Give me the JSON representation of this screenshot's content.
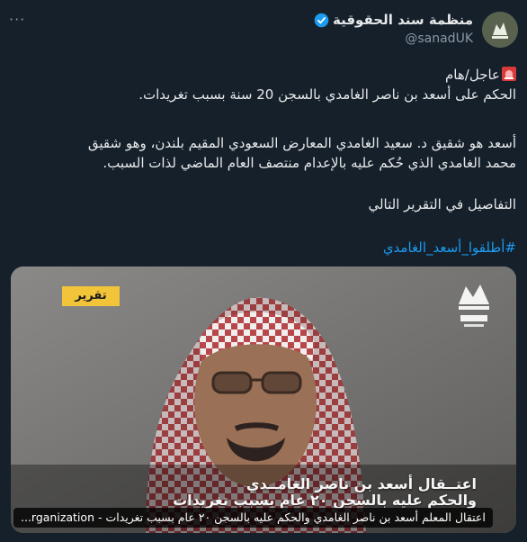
{
  "tweet": {
    "more_label": "···",
    "author": {
      "name": "منظمة سند الحقوقية",
      "handle": "@sanadUK",
      "verified": true
    },
    "lines": [
      "عاجل/هام",
      "الحكم على أسعد بن ناصر الغامدي بالسجن 20 سنة بسبب تغريدات.",
      "أسعد هو شقيق د. سعيد الغامدي المعارض السعودي المقيم بلندن، وهو شقيق",
      "محمد الغامدي الذي حُكم عليه بالإعدام منتصف العام الماضي لذات السبب.",
      "التفاصيل في التقرير التالي"
    ],
    "hashtag": "#أطلقوا_أسعد_الغامدي",
    "emoji": "siren-icon"
  },
  "media": {
    "tag": "تقرير",
    "logo_name": "sanad-logo",
    "caption_line1": "اعتــقال أسعد بن ناصر الغامــدي",
    "caption_line2": "والحكم عليه بالسجن ٢٠ عام بسبب تغريدات",
    "alt_text": "اعتقال المعلم أسعد بن ناصر الغامدي والحكم عليه بالسجن ٢٠ عام بسبب تغريدات - rganization..."
  },
  "colors": {
    "background": "#15202b",
    "link": "#1d9bf0",
    "muted": "#8b98a5",
    "tag": "#f2c43a"
  }
}
